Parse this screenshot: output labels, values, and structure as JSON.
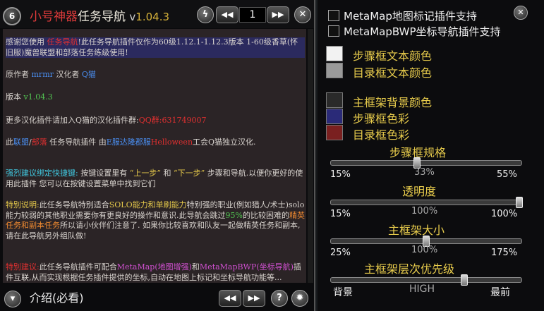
{
  "main": {
    "badge_number": "6",
    "title": {
      "part_red": "小号神器",
      "part_white": "任务导航",
      "part_v": "v",
      "part_version": "1.04.3"
    },
    "page_number": "1",
    "content": {
      "intro": "感谢您使用 任务导航!此任务导航插件仅作为60级1.12.1-1.12.3版本 1-60级香草(怀旧服)魔兽联盟和部落任务练级使用!",
      "intro_parts": [
        "感谢您使用 ",
        "任务导航",
        "!此任务导航插件仅作为60级1.12.1-1.12.3版本 1-60级香草(怀旧服)魔兽联盟和部落任务练级使用!"
      ],
      "author_parts": [
        "原作者 ",
        "mrmr",
        "汉化者 ",
        "Q猫"
      ],
      "version_parts": [
        "版本 ",
        "v1.04.3"
      ],
      "join_parts": [
        "更多汉化插件请加入Q猫的汉化插件群:",
        "QQ群:631749007"
      ],
      "line_alliance_parts": [
        "此",
        "联盟",
        "/",
        "部落",
        " 任务导航插件 由",
        "E服达隆郡服",
        "Helloween",
        "工会Q猫独立汉化."
      ],
      "bind_parts": [
        "强烈建议绑定快捷键:",
        " 按键设置里有 ",
        "“上一步”",
        " 和 ",
        "“下一步”",
        " 步骤和导航.以便你更好的使用此插件 您可以在按键设置菜单中找到它们"
      ],
      "special_parts": [
        "特别说明:",
        "此任务导航特别适合",
        "SOLO能力和单刷能力",
        "特别强的职业(例如猎人/术士)",
        "solo能力较弱的其他职业需要你有更良好的操作和意识.此导航会跳过",
        "95%",
        "的比较困难的",
        "精英任务和副本任务",
        "所以请小伙伴们注意了. 如果你比较喜欢和队友一起做精英任务和副本, 请在此导航另外组队做!"
      ],
      "suggest_parts": [
        "特别建议:",
        "此任务导航插件可配合",
        "MetaMap(地图增强)",
        "和",
        "MetaMapBWP(坐标导航)",
        "插件互联,从而实现根据任务插件提供的坐标,自动在地图上标记和坐标导航功能等..."
      ]
    },
    "bottom_label": "介绍(必看)"
  },
  "options": {
    "checkboxes": [
      {
        "label": "MetaMap地图标记插件支持",
        "checked": false
      },
      {
        "label": "MetaMapBWP坐标导航插件支持",
        "checked": false
      }
    ],
    "colors": [
      {
        "label": "步骤框文本颜色",
        "color": "#f2f2f2"
      },
      {
        "label": "目录框文本颜色",
        "color": "#9a9a9a"
      },
      {
        "label": "主框架背景颜色",
        "color": "#2a2a2a"
      },
      {
        "label": "步骤框色彩",
        "color": "#2a2a78"
      },
      {
        "label": "目录框色彩",
        "color": "#7a2020"
      }
    ],
    "sliders": [
      {
        "title": "步骤框规格",
        "min": "15%",
        "value": "33%",
        "max": "55%",
        "fraction": 0.45
      },
      {
        "title": "透明度",
        "min": "15%",
        "value": "100%",
        "max": "100%",
        "fraction": 0.99
      },
      {
        "title": "主框架大小",
        "min": "25%",
        "value": "100%",
        "max": "175%",
        "fraction": 0.5
      },
      {
        "title": "主框架层次优先级",
        "min": "背景",
        "value": "HIGH",
        "max": "最前",
        "fraction": 0.7
      }
    ]
  }
}
